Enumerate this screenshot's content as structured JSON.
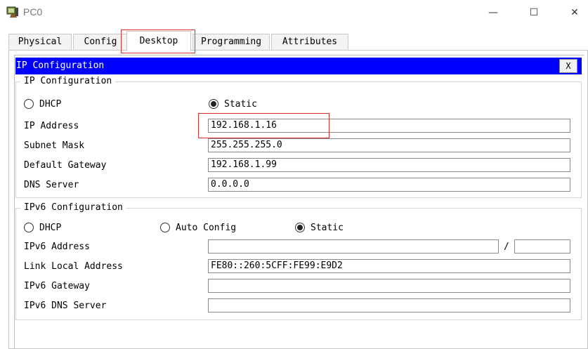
{
  "window": {
    "title": "PC0",
    "minimize_glyph": "—",
    "maximize_glyph": "☐",
    "close_glyph": "✕"
  },
  "tabs": [
    {
      "label": "Physical"
    },
    {
      "label": "Config"
    },
    {
      "label": "Desktop",
      "active": true
    },
    {
      "label": "Programming"
    },
    {
      "label": "Attributes"
    }
  ],
  "app": {
    "title": "IP Configuration",
    "close_label": "X"
  },
  "ipv4": {
    "legend": "IP Configuration",
    "dhcp_label": "DHCP",
    "static_label": "Static",
    "mode": "Static",
    "ip_address_label": "IP Address",
    "ip_address": "192.168.1.16",
    "subnet_mask_label": "Subnet Mask",
    "subnet_mask": "255.255.255.0",
    "default_gateway_label": "Default Gateway",
    "default_gateway": "192.168.1.99",
    "dns_server_label": "DNS Server",
    "dns_server": "0.0.0.0"
  },
  "ipv6": {
    "legend": "IPv6 Configuration",
    "dhcp_label": "DHCP",
    "auto_config_label": "Auto Config",
    "static_label": "Static",
    "mode": "Static",
    "address_label": "IPv6 Address",
    "address": "",
    "prefix_separator": "/",
    "prefix": "",
    "link_local_label": "Link Local Address",
    "link_local": "FE80::260:5CFF:FE99:E9D2",
    "gateway_label": "IPv6 Gateway",
    "gateway": "",
    "dns_label": "IPv6 DNS Server",
    "dns": ""
  },
  "colors": {
    "title_bar_blue": "#0000ff",
    "highlight_red": "#e03030"
  }
}
